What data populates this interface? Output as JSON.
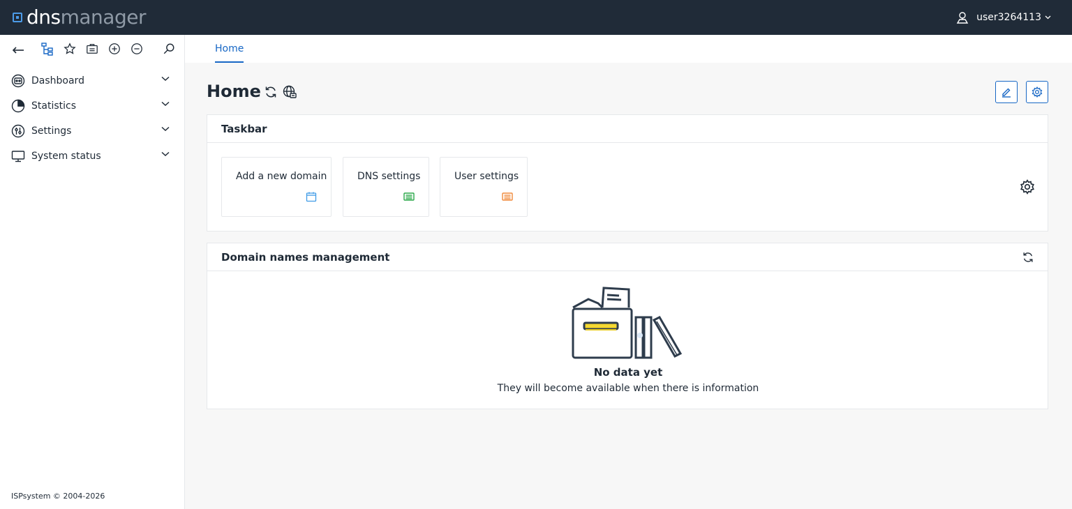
{
  "app": {
    "logo_dns": "dns",
    "logo_manager": "manager"
  },
  "user": {
    "name": "user3264113"
  },
  "sidebar": {
    "items": [
      {
        "label": "Dashboard"
      },
      {
        "label": "Statistics"
      },
      {
        "label": "Settings"
      },
      {
        "label": "System status"
      }
    ],
    "footer": "ISPsystem © 2004-2026"
  },
  "tabs": [
    {
      "label": "Home"
    }
  ],
  "page": {
    "title": "Home"
  },
  "taskbar": {
    "title": "Taskbar",
    "cards": [
      {
        "label": "Add a new domain",
        "color": "#3f9be6"
      },
      {
        "label": "DNS settings",
        "color": "#2ba84a"
      },
      {
        "label": "User settings",
        "color": "#f08a3c"
      }
    ]
  },
  "domains": {
    "title": "Domain names management",
    "empty_title": "No data yet",
    "empty_text": "They will become available when there is information"
  },
  "colors": {
    "accent": "#1767c5",
    "topbar": "#202b38",
    "logo_accent": "#4c9be8"
  }
}
